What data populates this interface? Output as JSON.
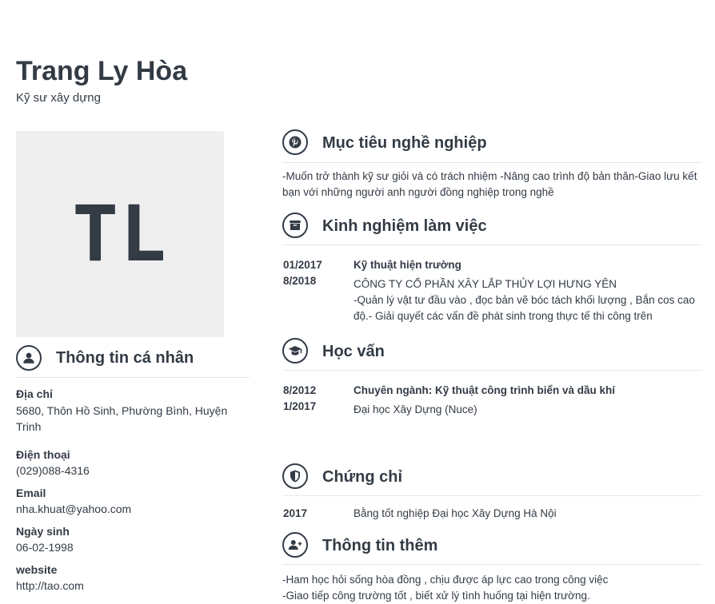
{
  "profile": {
    "name": "Trang Ly Hòa",
    "title": "Kỹ sư xây dựng",
    "initials": "TL"
  },
  "personal": {
    "heading": "Thông tin cá nhân",
    "address_label": "Địa chỉ",
    "address": "5680, Thôn Hồ Sinh, Phường Bình, Huyện Trinh",
    "phone_label": "Điện thoại",
    "phone": "(029)088-4316",
    "email_label": "Email",
    "email": "nha.khuat@yahoo.com",
    "birth_label": "Ngày sinh",
    "birth": "06-02-1998",
    "website_label": "website",
    "website": "http://tao.com"
  },
  "objective": {
    "heading": "Mục tiêu nghề nghiệp",
    "text": "-Muốn trở thành kỹ sư giỏi và có trách nhiệm -Nâng cao trình độ bản thân-Giao lưu kết bạn với những người anh người đồng nghiệp trong nghề"
  },
  "experience": {
    "heading": "Kinh nghiệm làm việc",
    "items": [
      {
        "from": "01/2017",
        "to": "8/2018",
        "role": "Kỹ thuật hiện trường",
        "company": "CÔNG TY CỔ PHẦN XÂY LẮP THỦY LỢI HƯNG YÊN",
        "desc": " -Quản lý vật tư đầu vào , đọc bản vẽ bóc tách khối lượng , Bắn cos cao độ.- Giải quyết các vấn đề phát sinh trong thực tế thi công trên"
      }
    ]
  },
  "education": {
    "heading": "Học vấn",
    "items": [
      {
        "from": "8/2012",
        "to": "1/2017",
        "major": "Chuyên ngành: Kỹ thuật công trình biển và dầu khí",
        "school": "Đại học Xây Dựng (Nuce)"
      }
    ]
  },
  "certificates": {
    "heading": "Chứng chỉ",
    "items": [
      {
        "year": "2017",
        "name": "Bằng tốt nghiệp Đại học Xây Dựng Hà Nội"
      }
    ]
  },
  "extra": {
    "heading": "Thông tin thêm",
    "line1": "-Ham học hỏi sống hòa đồng , chịu được áp lực cao trong công việc",
    "line2": "-Giao tiếp công trường tốt , biết xử lý tình huống tại hiện trường."
  },
  "icons": {
    "personal": "user-icon",
    "objective": "pinterest-icon",
    "experience": "archive-box-icon",
    "education": "graduation-cap-icon",
    "certificates": "shield-icon",
    "extra": "user-plus-icon"
  },
  "colors": {
    "text": "#333b45",
    "photo_bg": "#efefef",
    "rule": "#e6e6e6"
  }
}
